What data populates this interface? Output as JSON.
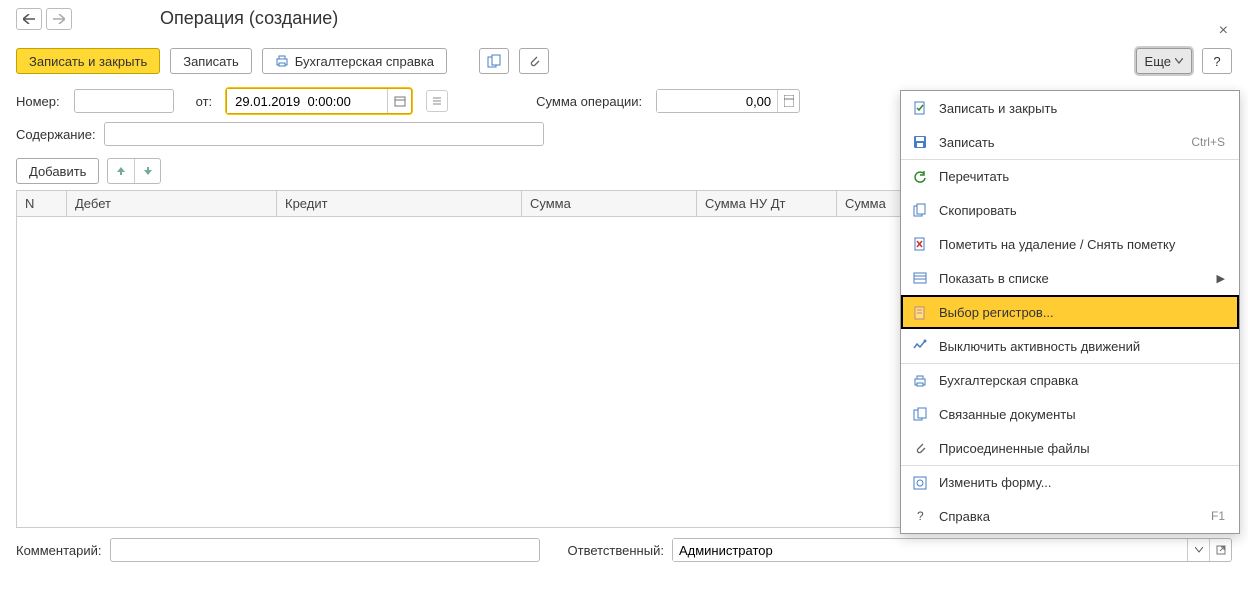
{
  "header": {
    "title": "Операция (создание)"
  },
  "toolbar": {
    "save_close": "Записать и закрыть",
    "save": "Записать",
    "report": "Бухгалтерская справка",
    "more": "Еще",
    "help": "?"
  },
  "form": {
    "number_label": "Номер:",
    "number_value": "",
    "date_label": "от:",
    "date_value": "29.01.2019  0:00:00",
    "sum_label": "Сумма операции:",
    "sum_value": "0,00",
    "content_label": "Содержание:",
    "content_value": "",
    "add_btn": "Добавить"
  },
  "table": {
    "columns": [
      "N",
      "Дебет",
      "Кредит",
      "Сумма",
      "Сумма НУ Дт",
      "Сумма"
    ]
  },
  "footer": {
    "comment_label": "Комментарий:",
    "comment_value": "",
    "responsible_label": "Ответственный:",
    "responsible_value": "Администратор"
  },
  "menu": {
    "items": [
      {
        "icon": "doc-check",
        "label": "Записать и закрыть",
        "shortcut": ""
      },
      {
        "icon": "save",
        "label": "Записать",
        "shortcut": "Ctrl+S"
      },
      {
        "icon": "refresh",
        "label": "Перечитать",
        "shortcut": "",
        "sep": true
      },
      {
        "icon": "copy",
        "label": "Скопировать",
        "shortcut": ""
      },
      {
        "icon": "delete-mark",
        "label": "Пометить на удаление / Снять пометку",
        "shortcut": ""
      },
      {
        "icon": "list",
        "label": "Показать в списке",
        "shortcut": "",
        "arrow": true
      },
      {
        "icon": "registers",
        "label": "Выбор регистров...",
        "shortcut": "",
        "highlight": true,
        "sep": true
      },
      {
        "icon": "activity",
        "label": "Выключить активность движений",
        "shortcut": ""
      },
      {
        "icon": "print",
        "label": "Бухгалтерская справка",
        "shortcut": "",
        "sep": true
      },
      {
        "icon": "linked",
        "label": "Связанные документы",
        "shortcut": ""
      },
      {
        "icon": "attach",
        "label": "Присоединенные файлы",
        "shortcut": ""
      },
      {
        "icon": "form",
        "label": "Изменить форму...",
        "shortcut": "",
        "sep": true
      },
      {
        "icon": "help",
        "label": "Справка",
        "shortcut": "F1"
      }
    ]
  }
}
